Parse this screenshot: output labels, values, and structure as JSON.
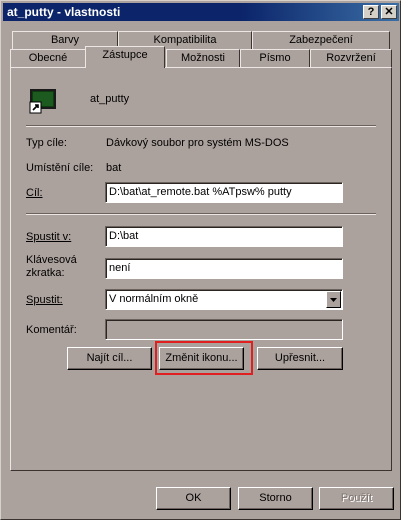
{
  "window": {
    "title": "at_putty - vlastnosti",
    "help_button": "?",
    "close_button": "✕"
  },
  "tabs_back_row": [
    "Barvy",
    "Kompatibilita",
    "Zabezpečení"
  ],
  "tabs_front_row": [
    "Obecné",
    "Zástupce",
    "Možnosti",
    "Písmo",
    "Rozvržení"
  ],
  "active_tab": "Zástupce",
  "shortcut": {
    "name": "at_putty",
    "target_type_label": "Typ cíle:",
    "target_type_value": "Dávkový soubor pro systém MS-DOS",
    "target_location_label": "Umístění cíle:",
    "target_location_value": "bat",
    "target_label": "Cíl:",
    "target_value": "D:\\bat\\at_remote.bat %ATpsw% putty",
    "start_in_label": "Spustit v:",
    "start_in_value": "D:\\bat",
    "hotkey_label_line1": "Klávesová",
    "hotkey_label_line2": "zkratka:",
    "hotkey_value": "není",
    "run_label": "Spustit:",
    "run_value": "V normálním okně",
    "comment_label": "Komentář:",
    "comment_value": ""
  },
  "buttons": {
    "find_target": "Najít cíl...",
    "change_icon": "Změnit ikonu...",
    "advanced": "Upřesnit...",
    "ok": "OK",
    "cancel": "Storno",
    "apply": "Použít"
  },
  "colors": {
    "titlebar": "#0b246a",
    "window_face": "#aca29d",
    "highlight_box": "#e02020"
  },
  "icons": {
    "shortcut_icon": "ms-dos-shortcut-icon",
    "dropdown": "chevron-down-icon"
  }
}
